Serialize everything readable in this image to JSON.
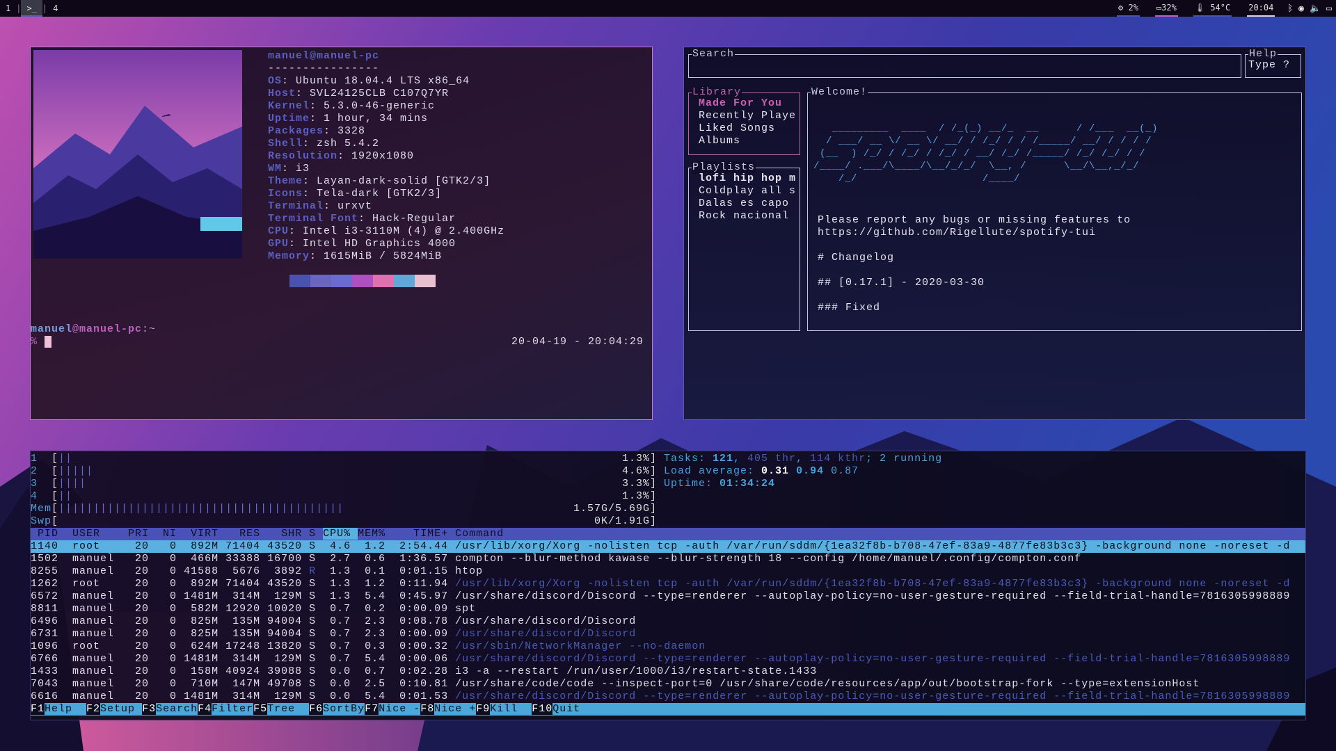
{
  "topbar": {
    "workspaces": [
      "1",
      "4"
    ],
    "active_workspace": ">_",
    "separator": "|",
    "cpu": "2%",
    "ram": "32%",
    "temp": "54°C",
    "clock": "20:04",
    "colors": {
      "cpu": "#4a52b8",
      "ram": "#c060c0",
      "temp": "#4a52b8",
      "clock": "#e0d0e8"
    }
  },
  "terminal": {
    "title_user": "manuel@manuel-pc",
    "rule": "----------------",
    "info": [
      {
        "k": "OS",
        "v": "Ubuntu 18.04.4 LTS x86_64"
      },
      {
        "k": "Host",
        "v": "SVL24125CLB C107Q7YR"
      },
      {
        "k": "Kernel",
        "v": "5.3.0-46-generic"
      },
      {
        "k": "Uptime",
        "v": "1 hour, 34 mins"
      },
      {
        "k": "Packages",
        "v": "3328"
      },
      {
        "k": "Shell",
        "v": "zsh 5.4.2"
      },
      {
        "k": "Resolution",
        "v": "1920x1080"
      },
      {
        "k": "WM",
        "v": "i3"
      },
      {
        "k": "Theme",
        "v": "Layan-dark-solid [GTK2/3]"
      },
      {
        "k": "Icons",
        "v": "Tela-dark [GTK2/3]"
      },
      {
        "k": "Terminal",
        "v": "urxvt"
      },
      {
        "k": "Terminal Font",
        "v": "Hack-Regular"
      },
      {
        "k": "CPU",
        "v": "Intel i3-3110M (4) @ 2.400GHz"
      },
      {
        "k": "GPU",
        "v": "Intel HD Graphics 4000"
      },
      {
        "k": "Memory",
        "v": "1615MiB / 5824MiB"
      }
    ],
    "palette": [
      "#4a52b0",
      "#6a66c0",
      "#6a6ad0",
      "#b050c0",
      "#e070b0",
      "#60a8d8",
      "#e8c0d0"
    ],
    "prompt_user": "manuel",
    "prompt_at": "@",
    "prompt_host": "manuel-pc",
    "prompt_path": ":~",
    "prompt_symbol": "%",
    "datetime": "20-04-19 - 20:04:29"
  },
  "spotify": {
    "search_label": "Search",
    "search_value": "",
    "help_label": "Help",
    "help_text": "Type ?",
    "library_label": "Library",
    "library": [
      "Made For You",
      "Recently Playe",
      "Liked Songs",
      "Albums"
    ],
    "playlists_label": "Playlists",
    "playlists": [
      "lofi hip hop m",
      "Coldplay all s",
      "Dalas es capo",
      "Rock nacional"
    ],
    "welcome_label": "Welcome!",
    "ascii": [
      "   _________  ____  / /_(_) __/_  __      / /___  __(_)",
      "  / ___/ __ \\/ __ \\/ __/ / /_/ / / /_____/ __/ / / / /",
      " (__  ) /_/ / /_/ / /_/ / __/ /_/ /_____/ /_/ /_/ / /",
      "/____/ .___/\\____/\\__/_/_/  \\__, /      \\__/\\__,_/_/",
      "    /_/                    /____/"
    ],
    "report": "Please report any bugs or missing features to",
    "url": "https://github.com/Rigellute/spotify-tui",
    "changelog": "# Changelog",
    "version": "## [0.17.1] - 2020-03-30",
    "fixed": "### Fixed"
  },
  "htop": {
    "cpus": [
      {
        "n": "1",
        "pct": "1.3%",
        "bars": 2
      },
      {
        "n": "2",
        "pct": "4.6%",
        "bars": 5
      },
      {
        "n": "3",
        "pct": "3.3%",
        "bars": 4
      },
      {
        "n": "4",
        "pct": "1.3%",
        "bars": 2
      }
    ],
    "mem": {
      "label": "Mem",
      "value": "1.57G/5.69G",
      "fraction": 0.276
    },
    "swp": {
      "label": "Swp",
      "value": "0K/1.91G",
      "fraction": 0
    },
    "tasks": {
      "label": "Tasks: ",
      "count": "121",
      "sep1": ", ",
      "thr": "405 thr",
      "sep2": ", ",
      "kthr": "114 kthr",
      "running": "; 2 running"
    },
    "load": {
      "label": "Load average: ",
      "l1": "0.31",
      "l5": "0.94",
      "l15": "0.87"
    },
    "uptime": {
      "label": "Uptime: ",
      "value": "01:34:24"
    },
    "columns": [
      "PID",
      "USER",
      "PRI",
      "NI",
      "VIRT",
      "RES",
      "SHR",
      "S",
      "CPU%",
      "MEM%",
      "TIME+",
      "Command"
    ],
    "rows": [
      [
        "1140",
        "root",
        "20",
        "0",
        "892M",
        "71404",
        "43520",
        "S",
        "4.6",
        "1.2",
        "2:54.44",
        "/usr/lib/xorg/Xorg -nolisten tcp -auth /var/run/sddm/{1ea32f8b-b708-47ef-83a9-4877fe83b3c3} -background none -noreset -d"
      ],
      [
        "1502",
        "manuel",
        "20",
        "0",
        "466M",
        "33388",
        "16700",
        "S",
        "2.7",
        "0.6",
        "1:36.57",
        "compton --blur-method kawase --blur-strength 18 --config /home/manuel/.config/compton.conf"
      ],
      [
        "8255",
        "manuel",
        "20",
        "0",
        "41588",
        "5676",
        "3892",
        "R",
        "1.3",
        "0.1",
        "0:01.15",
        "htop"
      ],
      [
        "1262",
        "root",
        "20",
        "0",
        "892M",
        "71404",
        "43520",
        "S",
        "1.3",
        "1.2",
        "0:11.94",
        "/usr/lib/xorg/Xorg -nolisten tcp -auth /var/run/sddm/{1ea32f8b-b708-47ef-83a9-4877fe83b3c3} -background none -noreset -d"
      ],
      [
        "6572",
        "manuel",
        "20",
        "0",
        "1481M",
        "314M",
        "129M",
        "S",
        "1.3",
        "5.4",
        "0:45.97",
        "/usr/share/discord/Discord --type=renderer --autoplay-policy=no-user-gesture-required --field-trial-handle=7816305998889"
      ],
      [
        "8811",
        "manuel",
        "20",
        "0",
        "582M",
        "12920",
        "10020",
        "S",
        "0.7",
        "0.2",
        "0:00.09",
        "spt"
      ],
      [
        "6496",
        "manuel",
        "20",
        "0",
        "825M",
        "135M",
        "94004",
        "S",
        "0.7",
        "2.3",
        "0:08.78",
        "/usr/share/discord/Discord"
      ],
      [
        "6731",
        "manuel",
        "20",
        "0",
        "825M",
        "135M",
        "94004",
        "S",
        "0.7",
        "2.3",
        "0:00.09",
        "/usr/share/discord/Discord"
      ],
      [
        "1096",
        "root",
        "20",
        "0",
        "624M",
        "17248",
        "13820",
        "S",
        "0.7",
        "0.3",
        "0:00.32",
        "/usr/sbin/NetworkManager --no-daemon"
      ],
      [
        "6766",
        "manuel",
        "20",
        "0",
        "1481M",
        "314M",
        "129M",
        "S",
        "0.7",
        "5.4",
        "0:00.06",
        "/usr/share/discord/Discord --type=renderer --autoplay-policy=no-user-gesture-required --field-trial-handle=7816305998889"
      ],
      [
        "1433",
        "manuel",
        "20",
        "0",
        "158M",
        "40924",
        "39088",
        "S",
        "0.0",
        "0.7",
        "0:02.28",
        "i3 -a --restart /run/user/1000/i3/restart-state.1433"
      ],
      [
        "7043",
        "manuel",
        "20",
        "0",
        "710M",
        "147M",
        "49708",
        "S",
        "0.0",
        "2.5",
        "0:10.81",
        "/usr/share/code/code --inspect-port=0 /usr/share/code/resources/app/out/bootstrap-fork --type=extensionHost"
      ],
      [
        "6616",
        "manuel",
        "20",
        "0",
        "1481M",
        "314M",
        "129M",
        "S",
        "0.0",
        "5.4",
        "0:01.53",
        "/usr/share/discord/Discord --type=renderer --autoplay-policy=no-user-gesture-required --field-trial-handle=7816305998889"
      ]
    ],
    "thread_rows": [
      3,
      7,
      8,
      9,
      12
    ],
    "selected_row": 0,
    "fkeys": [
      {
        "k": "F1",
        "l": "Help  "
      },
      {
        "k": "F2",
        "l": "Setup "
      },
      {
        "k": "F3",
        "l": "Search"
      },
      {
        "k": "F4",
        "l": "Filter"
      },
      {
        "k": "F5",
        "l": "Tree  "
      },
      {
        "k": "F6",
        "l": "SortBy"
      },
      {
        "k": "F7",
        "l": "Nice -"
      },
      {
        "k": "F8",
        "l": "Nice +"
      },
      {
        "k": "F9",
        "l": "Kill  "
      },
      {
        "k": "F10",
        "l": "Quit"
      }
    ]
  }
}
